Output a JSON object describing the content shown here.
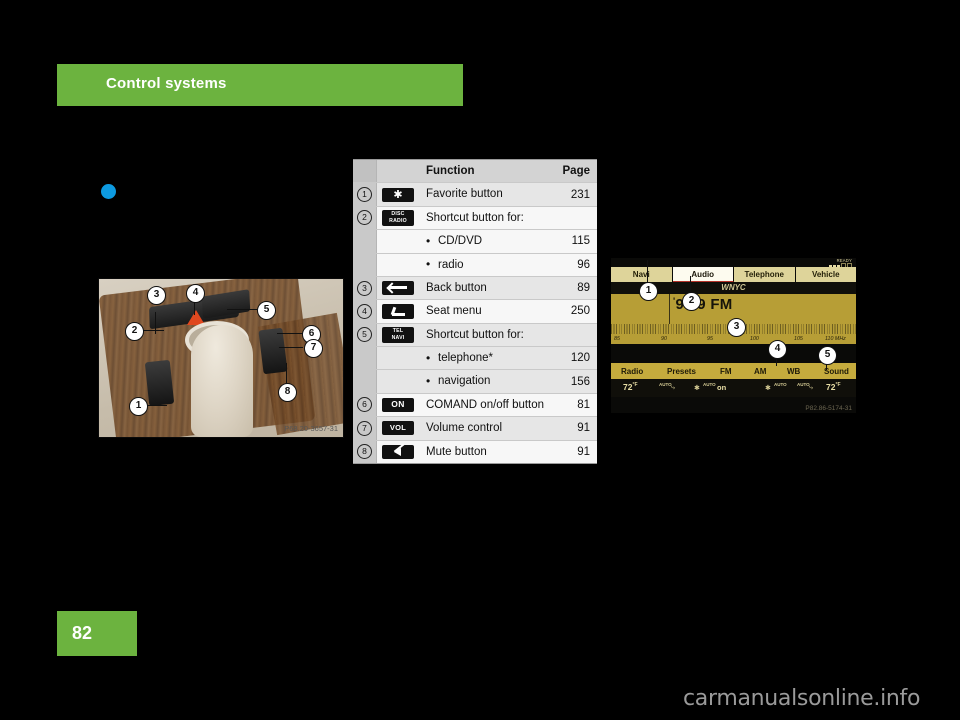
{
  "header": {
    "chapter_title": "Control systems",
    "accent_color": "#6cb33f"
  },
  "page_footer": {
    "page_number": "82"
  },
  "watermark": {
    "text": "carmanualsonline.info"
  },
  "console_photo": {
    "caption": "P68.20-3657-31",
    "callouts": [
      "1",
      "2",
      "3",
      "4",
      "5",
      "6",
      "7",
      "8"
    ]
  },
  "function_table": {
    "columns": {
      "function": "Function",
      "page": "Page"
    },
    "rows": [
      {
        "num": "1",
        "icon": "favorite-star-icon",
        "icon_text": "",
        "label": "Favorite button",
        "page": "231",
        "sub": false
      },
      {
        "num": "2",
        "icon": "disc-radio-icon",
        "icon_text": "DISC RADIO",
        "label": "Shortcut button for:",
        "page": "",
        "sub": false
      },
      {
        "num": "",
        "icon": "",
        "icon_text": "",
        "label": "CD/DVD",
        "page": "115",
        "sub": true
      },
      {
        "num": "",
        "icon": "",
        "icon_text": "",
        "label": "radio",
        "page": "96",
        "sub": true
      },
      {
        "num": "3",
        "icon": "back-arrow-icon",
        "icon_text": "",
        "label": "Back button",
        "page": "89",
        "sub": false
      },
      {
        "num": "4",
        "icon": "seat-menu-icon",
        "icon_text": "",
        "label": "Seat menu",
        "page": "250",
        "sub": false
      },
      {
        "num": "5",
        "icon": "tel-navi-icon",
        "icon_text": "TEL NAVI",
        "label": "Shortcut button for:",
        "page": "",
        "sub": false
      },
      {
        "num": "",
        "icon": "",
        "icon_text": "",
        "label": "telephone*",
        "page": "120",
        "sub": true
      },
      {
        "num": "",
        "icon": "",
        "icon_text": "",
        "label": "navigation",
        "page": "156",
        "sub": true
      },
      {
        "num": "6",
        "icon": "comand-on-icon",
        "icon_text": "ON",
        "label": "COMAND on/off button",
        "page": "81",
        "sub": false
      },
      {
        "num": "7",
        "icon": "volume-icon",
        "icon_text": "VOL",
        "label": "Volume control",
        "page": "91",
        "sub": false
      },
      {
        "num": "8",
        "icon": "mute-icon",
        "icon_text": "",
        "label": "Mute button",
        "page": "91",
        "sub": false
      }
    ]
  },
  "comand_display": {
    "caption": "P82.86-5174-31",
    "status": {
      "ready_label": "READY",
      "signal_bars_filled": 3,
      "signal_bars_total": 5
    },
    "tabs": [
      {
        "label": "Navi",
        "active": false
      },
      {
        "label": "Audio",
        "active": true
      },
      {
        "label": "Telephone",
        "active": false
      },
      {
        "label": "Vehicle",
        "active": false
      }
    ],
    "station_name": "WNYC",
    "frequency": "93.9 FM",
    "scale_labels": [
      "85",
      "90",
      "95",
      "100",
      "105",
      "110 MHz"
    ],
    "menu_items": [
      "Radio",
      "Presets",
      "FM",
      "AM",
      "WB",
      "Sound"
    ],
    "climate": {
      "temp_left": "72",
      "temp_right": "72",
      "unit": "°F",
      "auto_label": "AUTO",
      "blower_label": "on"
    },
    "callouts": [
      "1",
      "2",
      "3",
      "4",
      "5"
    ],
    "colors": {
      "panel_gold": "#b79e36",
      "tab_gold": "#ded49a",
      "active_tab": "#fdfbef",
      "accent_red": "#b5332a"
    }
  }
}
